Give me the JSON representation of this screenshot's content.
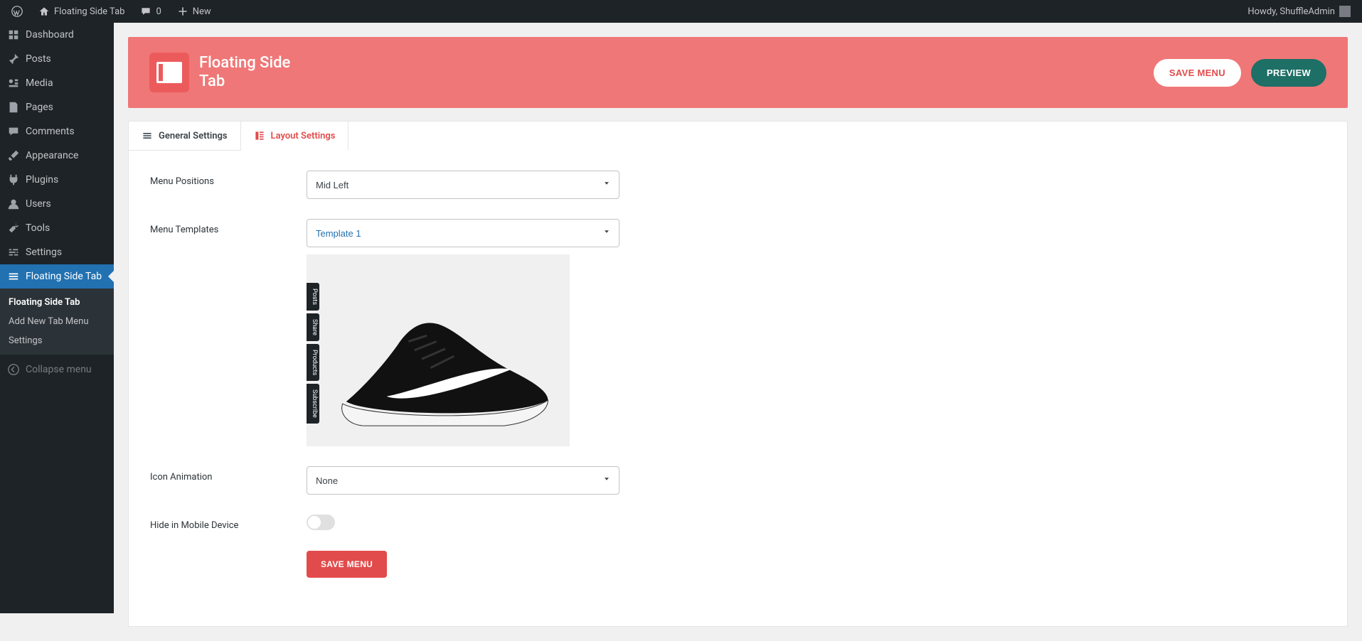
{
  "adminbar": {
    "site_name": "Floating Side Tab",
    "comments_count": "0",
    "new_label": "New",
    "greeting": "Howdy, ShuffleAdmin"
  },
  "menu": {
    "items": [
      {
        "key": "dashboard",
        "label": "Dashboard"
      },
      {
        "key": "posts",
        "label": "Posts"
      },
      {
        "key": "media",
        "label": "Media"
      },
      {
        "key": "pages",
        "label": "Pages"
      },
      {
        "key": "comments",
        "label": "Comments"
      },
      {
        "key": "appearance",
        "label": "Appearance"
      },
      {
        "key": "plugins",
        "label": "Plugins"
      },
      {
        "key": "users",
        "label": "Users"
      },
      {
        "key": "tools",
        "label": "Tools"
      },
      {
        "key": "settings",
        "label": "Settings"
      },
      {
        "key": "floating",
        "label": "Floating Side Tab",
        "current": true
      }
    ],
    "submenu": [
      {
        "label": "Floating Side Tab",
        "selected": true
      },
      {
        "label": "Add New Tab Menu"
      },
      {
        "label": "Settings"
      }
    ],
    "collapse_label": "Collapse menu"
  },
  "plugin": {
    "title": "Floating Side Tab",
    "save_btn": "SAVE MENU",
    "preview_btn": "PREVIEW"
  },
  "tabs": {
    "general": "General Settings",
    "layout": "Layout Settings"
  },
  "form": {
    "menu_positions_label": "Menu Positions",
    "menu_positions_value": "Mid Left",
    "menu_templates_label": "Menu Templates",
    "menu_templates_value": "Template 1",
    "icon_animation_label": "Icon Animation",
    "icon_animation_value": "None",
    "hide_mobile_label": "Hide in Mobile Device",
    "hide_mobile_checked": false,
    "save_label": "SAVE MENU",
    "preview_tabs": [
      "Posts",
      "Share",
      "Products",
      "Subscribe"
    ]
  }
}
